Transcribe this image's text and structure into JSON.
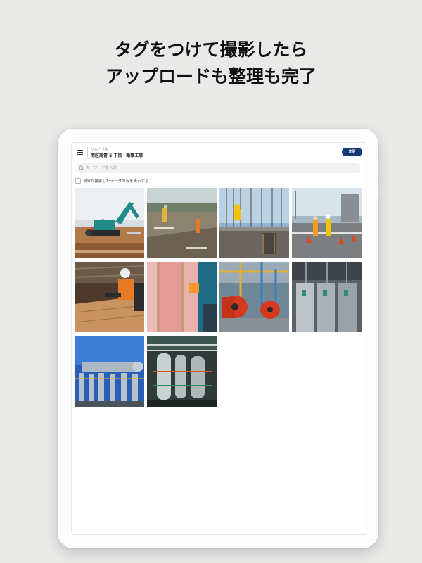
{
  "headline": {
    "line1": "タグをつけて撮影したら",
    "line2": "アップロードも整理も完了"
  },
  "app": {
    "group_label": "グループ名",
    "group_name": "港区南青 5 丁目　新築工事",
    "change_button": "変更",
    "search_placeholder": "キーワードを入力",
    "filter_label": "自分が撮影したデータのみを表示する",
    "filter_checked": false
  },
  "photos": [
    {
      "subject": "excavator"
    },
    {
      "subject": "site-survey"
    },
    {
      "subject": "rebar-worker"
    },
    {
      "subject": "street-crew"
    },
    {
      "subject": "carpenter"
    },
    {
      "subject": "insulation"
    },
    {
      "subject": "red-boilers"
    },
    {
      "subject": "gray-heaters"
    },
    {
      "subject": "water-tanks"
    },
    {
      "subject": "pipe-plant"
    }
  ],
  "colors": {
    "accent": "#103a75",
    "background": "#e9e9e7"
  }
}
